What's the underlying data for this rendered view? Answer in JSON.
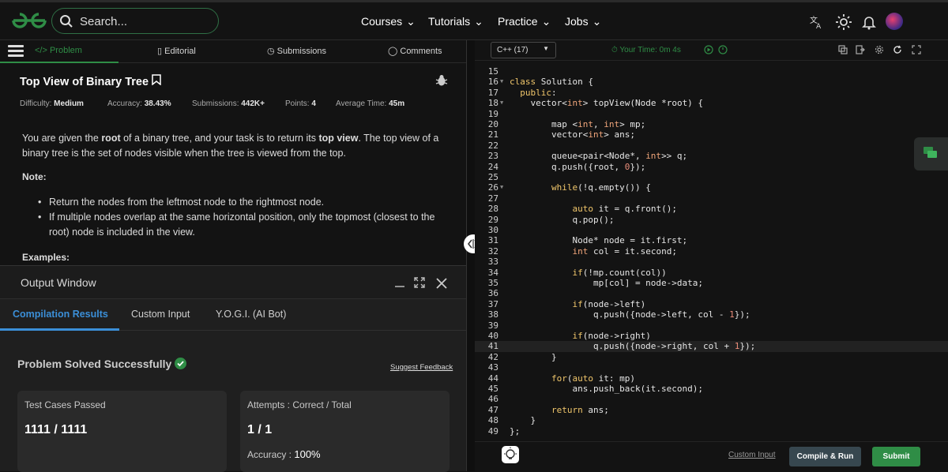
{
  "topbar": {
    "search_placeholder": "Search...",
    "nav": [
      "Courses",
      "Tutorials",
      "Practice",
      "Jobs"
    ]
  },
  "tabs": {
    "problem": "Problem",
    "editorial": "Editorial",
    "submissions": "Submissions",
    "comments": "Comments"
  },
  "problem": {
    "title": "Top View of Binary Tree",
    "difficulty_label": "Difficulty:",
    "difficulty": "Medium",
    "accuracy_label": "Accuracy:",
    "accuracy": "38.43%",
    "submissions_label": "Submissions:",
    "submissions": "442K+",
    "points_label": "Points:",
    "points": "4",
    "avgtime_label": "Average Time:",
    "avgtime": "45m",
    "desc_1": "You are given the ",
    "desc_root": "root",
    "desc_2": " of a binary tree, and your task is to return its ",
    "desc_top": "top view",
    "desc_3": ". The top view of a binary tree is the set of nodes visible when the tree is viewed from the top.",
    "note": "Note:",
    "bullets": [
      "Return the nodes from the leftmost node to the rightmost node.",
      "If multiple nodes overlap at the same horizontal position, only the topmost (closest to the root) node is included in the view."
    ],
    "examples": "Examples:"
  },
  "output": {
    "title": "Output Window",
    "tabs": [
      "Compilation Results",
      "Custom Input",
      "Y.O.G.I. (AI Bot)"
    ],
    "solved": "Problem Solved Successfully",
    "feedback": "Suggest Feedback",
    "card1_title": "Test Cases Passed",
    "card1_value": "1111 / 1111",
    "card2_title": "Attempts : Correct / Total",
    "card2_value": "1 / 1",
    "accuracy_label": "Accuracy :",
    "accuracy_value": "100%"
  },
  "editor": {
    "language": "C++ (17)",
    "timer": "Your Time: 0m 4s",
    "custom_input": "Custom Input",
    "compile_run": "Compile & Run",
    "submit": "Submit"
  },
  "colors": {
    "accent": "#2f8d46",
    "tab_blue": "#3b8fd8"
  }
}
